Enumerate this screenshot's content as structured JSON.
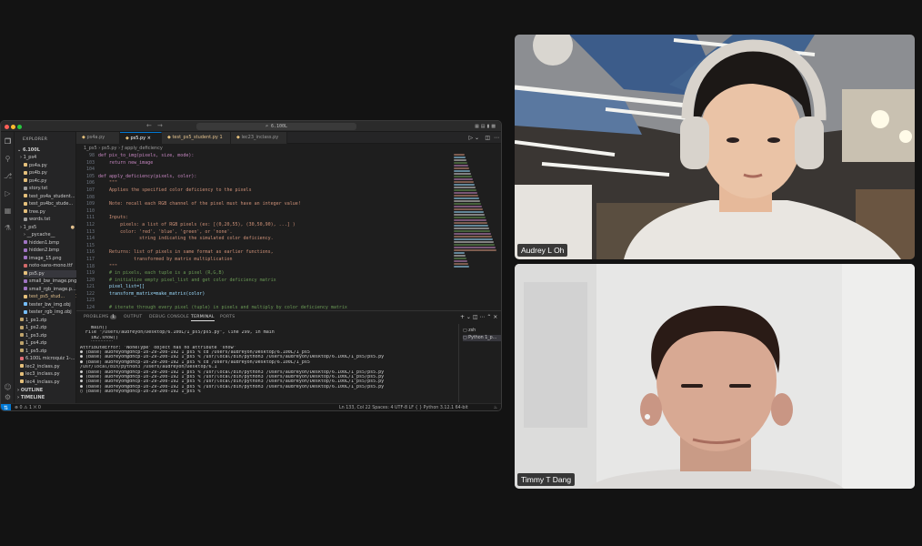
{
  "window": {
    "command_center": "⌕ 6.100L"
  },
  "explorer": {
    "title": "EXPLORER",
    "root": "6.100L",
    "items": [
      {
        "label": "1_ps4",
        "type": "folder",
        "color": "#cccccc"
      },
      {
        "label": "ps4a.py",
        "type": "py",
        "color": "#cccccc"
      },
      {
        "label": "ps4b.py",
        "type": "py",
        "color": "#cccccc"
      },
      {
        "label": "ps4c.py",
        "type": "py",
        "color": "#cccccc"
      },
      {
        "label": "story.txt",
        "type": "txt",
        "color": "#cccccc"
      },
      {
        "label": "test_ps4a_student...",
        "type": "py",
        "color": "#cccccc"
      },
      {
        "label": "test_ps4bc_stude...",
        "type": "py",
        "color": "#cccccc"
      },
      {
        "label": "tree.py",
        "type": "py",
        "color": "#cccccc"
      },
      {
        "label": "words.txt",
        "type": "txt",
        "color": "#cccccc"
      },
      {
        "label": "1_ps5",
        "type": "folder",
        "color": "#cccccc",
        "badge": "●"
      },
      {
        "label": "__pycache__",
        "type": "folder",
        "color": "#cccccc"
      },
      {
        "label": "hidden1.bmp",
        "type": "img",
        "color": "#cccccc"
      },
      {
        "label": "hidden2.bmp",
        "type": "img",
        "color": "#cccccc"
      },
      {
        "label": "image_15.png",
        "type": "img",
        "color": "#cccccc"
      },
      {
        "label": "noto-sans-mono.ttf",
        "type": "ttf",
        "color": "#cccccc"
      },
      {
        "label": "ps5.py",
        "type": "py",
        "color": "#cccccc",
        "selected": true
      },
      {
        "label": "small_bw_image.png",
        "type": "img",
        "color": "#cccccc"
      },
      {
        "label": "small_rgb_image.p...",
        "type": "img",
        "color": "#cccccc"
      },
      {
        "label": "test_ps5_stud...",
        "type": "py",
        "color": "#e2c08d",
        "badge": "1"
      },
      {
        "label": "tester_bw_img.obj",
        "type": "obj",
        "color": "#cccccc"
      },
      {
        "label": "tester_rgb_img.obj",
        "type": "obj",
        "color": "#cccccc"
      },
      {
        "label": "1_ps1.zip",
        "type": "zip",
        "color": "#cccccc"
      },
      {
        "label": "1_ps2.zip",
        "type": "zip",
        "color": "#cccccc"
      },
      {
        "label": "1_ps3.zip",
        "type": "zip",
        "color": "#cccccc"
      },
      {
        "label": "1_ps4.zip",
        "type": "zip",
        "color": "#cccccc"
      },
      {
        "label": "1_ps5.zip",
        "type": "zip",
        "color": "#cccccc"
      },
      {
        "label": "6.100L microquiz 1-...",
        "type": "pdf",
        "color": "#cccccc"
      },
      {
        "label": "lec2_inclass.py",
        "type": "py",
        "color": "#cccccc"
      },
      {
        "label": "lec3_inclass.py",
        "type": "py",
        "color": "#cccccc"
      },
      {
        "label": "lec4_inclass.py",
        "type": "py",
        "color": "#cccccc"
      }
    ],
    "outline": "OUTLINE",
    "timeline": "TIMELINE"
  },
  "tabs": [
    {
      "label": "ps4a.py",
      "active": false
    },
    {
      "label": "ps5.py",
      "active": true
    },
    {
      "label": "test_ps5_student.py 1",
      "active": false
    },
    {
      "label": "lec23_inclass.py",
      "active": false
    }
  ],
  "breadcrumb": "1_ps5 › ps5.py › ƒ apply_deficiency",
  "code": {
    "line_numbers": [
      "98",
      "103",
      "104",
      "105",
      "106",
      "107",
      "108",
      "109",
      "110",
      "111",
      "112",
      "113",
      "114",
      "115",
      "116",
      "117",
      "118",
      "119",
      "120",
      "121",
      "122",
      "123",
      "124"
    ],
    "lines": [
      "def pix_to_img(pixels, size, mode):",
      "    return new_image",
      "",
      "def apply_deficiency(pixels, color):",
      "    \"\"\"",
      "    Applies the specified color deficiency to the pixels",
      "",
      "    Note: recall each RGB channel of the pixel must have an integer value!",
      "",
      "    Inputs:",
      "        pixels: a list of RGB pixels (ex: [(0,20,55), (30,50,90), ...] )",
      "        color: 'red', 'blue', 'green', or 'none'.",
      "               string indicating the simulated color deficiency.",
      "",
      "    Returns: list of pixels in same format as earlier functions,",
      "             transformed by matrix multiplication",
      "    \"\"\"",
      "    # in pixels, each tuple is a pixel (R,G,B)",
      "    # initialize empty pixel_list and get color deficiency matrix",
      "    pixel_list=[]",
      "    transform_matrix=make_matrix(color)",
      "",
      "    # iterate through every pixel (tuple) in pixels and multiply by color deficiency matrix",
      "    for pixel in pixels:"
    ]
  },
  "panel": {
    "tabs": [
      "PROBLEMS",
      "OUTPUT",
      "DEBUG CONSOLE",
      "TERMINAL",
      "PORTS"
    ],
    "problems_count": "1",
    "terminal": [
      "    main()",
      "  File \"/Users/audreyoh/Desktop/6.100L/1_ps5/ps5.py\", line 299, in main",
      "    im2.show()",
      "    ^^^^^^^^",
      "AttributeError: 'NoneType' object has no attribute 'show'",
      "● (base) audreyoh@dhcp-10-29-200-192 1_ps5 % cd /Users/audreyoh/Desktop/6.100L/1_ps5",
      "● (base) audreyoh@dhcp-10-29-200-192 1_ps5 % /usr/local/bin/python3 /Users/audreyoh/Desktop/6.100L/1_ps5/ps5.py",
      "● (base) audreyoh@dhcp-10-29-200-192 1_ps5 % cd /Users/audreyoh/Desktop/6.100L/1_ps5",
      "/usr/local/bin/python3 /Users/audreyoh/Desktop/6.1",
      "● (base) audreyoh@dhcp-10-29-200-192 1_ps5 % /usr/local/bin/python3 /Users/audreyoh/Desktop/6.100L/1_ps5/ps5.py",
      "● (base) audreyoh@dhcp-10-29-200-192 1_ps5 % /usr/local/bin/python3 /Users/audreyoh/Desktop/6.100L/1_ps5/ps5.py",
      "● (base) audreyoh@dhcp-10-29-200-192 1_ps5 % /usr/local/bin/python3 /Users/audreyoh/Desktop/6.100L/1_ps5/ps5.py",
      "● (base) audreyoh@dhcp-10-29-200-192 1_ps5 % /usr/local/bin/python3 /Users/audreyoh/Desktop/6.100L/1_ps5/ps5.py",
      "○ (base) audreyoh@dhcp-10-29-200-192 1_ps5 % "
    ],
    "sessions": [
      "zsh",
      "Python 1_p..."
    ]
  },
  "status": {
    "left": "⊗ 0 ⚠ 1   ⨉ 0",
    "right": "Ln 133, Col 22   Spaces: 4   UTF-8   LF   { } Python   3.12.1 64-bit"
  },
  "participants": [
    {
      "name": "Audrey L Oh"
    },
    {
      "name": "Timmy T Dang"
    }
  ]
}
